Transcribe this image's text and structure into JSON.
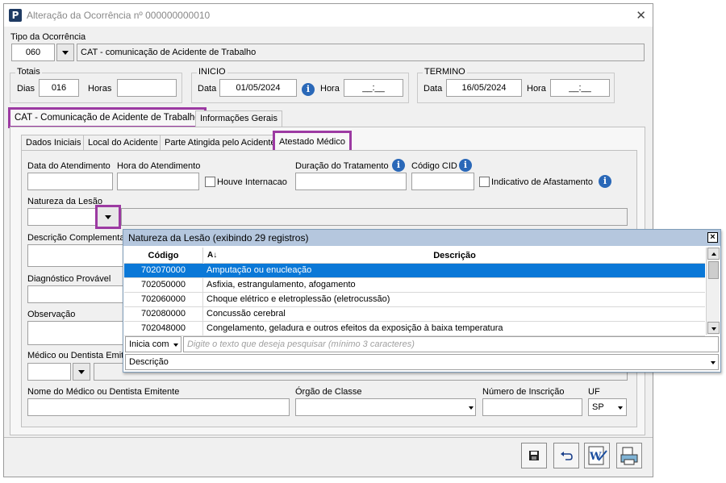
{
  "window": {
    "title": "Alteração da Ocorrência nº 000000000010",
    "app_icon": "P"
  },
  "tipo": {
    "label": "Tipo da Ocorrência",
    "code": "060",
    "description": "CAT - comunicação de Acidente de Trabalho"
  },
  "totais": {
    "title": "Totais",
    "dias_label": "Dias",
    "dias_value": "016",
    "horas_label": "Horas",
    "horas_value": ""
  },
  "inicio": {
    "title": "INICIO",
    "data_label": "Data",
    "data_value": "01/05/2024",
    "hora_label": "Hora",
    "hora_value": "__:__"
  },
  "termino": {
    "title": "TERMINO",
    "data_label": "Data",
    "data_value": "16/05/2024",
    "hora_label": "Hora",
    "hora_value": "__:__"
  },
  "main_tabs": [
    "CAT - Comunicação de Acidente de Trabalho",
    "Informações Gerais"
  ],
  "sub_tabs": [
    "Dados Iniciais",
    "Local do Acidente",
    "Parte Atingida pelo Acidente",
    "Atestado Médico"
  ],
  "form": {
    "data_atendimento": "Data do Atendimento",
    "hora_atendimento": "Hora do Atendimento",
    "houve_internacao": "Houve Internacao",
    "duracao_tratamento": "Duração do Tratamento",
    "codigo_cid": "Código CID",
    "indicativo_afastamento": "Indicativo de Afastamento",
    "natureza_lesao": "Natureza da Lesão",
    "descricao_complementar": "Descrição Complementar",
    "diagnostico_provavel": "Diagnóstico Provável",
    "observacao": "Observação",
    "medico_emitente": "Médico ou Dentista Emite",
    "nome_medico": "Nome do Médico ou Dentista Emitente",
    "orgao_classe": "Órgão de Classe",
    "numero_inscricao": "Número de Inscrição",
    "uf_label": "UF",
    "uf_value": "SP"
  },
  "popup": {
    "title": "Natureza da Lesão (exibindo 29 registros)",
    "col_codigo": "Código",
    "col_descricao": "Descrição",
    "rows": [
      {
        "codigo": "702070000",
        "descricao": "Amputação ou enucleação"
      },
      {
        "codigo": "702050000",
        "descricao": "Asfixia, estrangulamento, afogamento"
      },
      {
        "codigo": "702060000",
        "descricao": "Choque elétrico e eletroplessão (eletrocussão)"
      },
      {
        "codigo": "702080000",
        "descricao": "Concussão cerebral"
      },
      {
        "codigo": "702048000",
        "descricao": "Congelamento, geladura e outros efeitos da exposição à baixa temperatura"
      }
    ],
    "search_mode": "Inicia com",
    "search_placeholder": "Digite o texto que deseja pesquisar (mínimo 3 caracteres)",
    "search_field": "Descrição"
  },
  "colors": {
    "highlight": "#9c3aa2",
    "selection": "#0a78d7",
    "popup_header": "#b5c7de"
  }
}
